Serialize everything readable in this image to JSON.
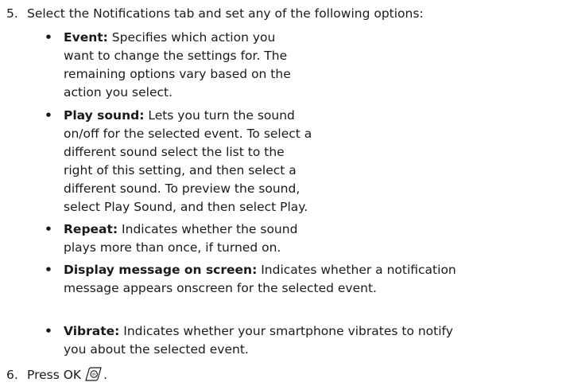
{
  "steps": [
    {
      "number": "5.",
      "text": "Select the Notifications tab and set any of the following options:"
    },
    {
      "number": "6.",
      "text": "Press OK",
      "trailing_icon": "ok-button-icon",
      "trailing_text": "."
    }
  ],
  "bullets": [
    {
      "symbol": "•",
      "term": "Event:",
      "lines": [
        " Specifies which action you",
        "want to change the settings for. The",
        "remaining options vary based on the",
        "action you select."
      ]
    },
    {
      "symbol": "•",
      "term": "Play sound:",
      "lines": [
        " Lets you turn the sound",
        "on/off for the selected event. To select a",
        "different sound select the list to the",
        "right of this setting, and then select a",
        "different sound. To preview the sound,",
        "select Play Sound, and then select Play."
      ]
    },
    {
      "symbol": "•",
      "term": "Repeat:",
      "lines": [
        " Indicates whether the sound",
        "plays more than once, if turned on."
      ]
    },
    {
      "symbol": "•",
      "term": "Display message on screen:",
      "lines": [
        " Indicates whether a notification",
        "message appears onscreen for the selected event."
      ]
    },
    {
      "symbol": "•",
      "term": "Vibrate:",
      "lines": [
        " Indicates whether your smartphone vibrates to notify",
        "you about the selected event."
      ]
    }
  ]
}
